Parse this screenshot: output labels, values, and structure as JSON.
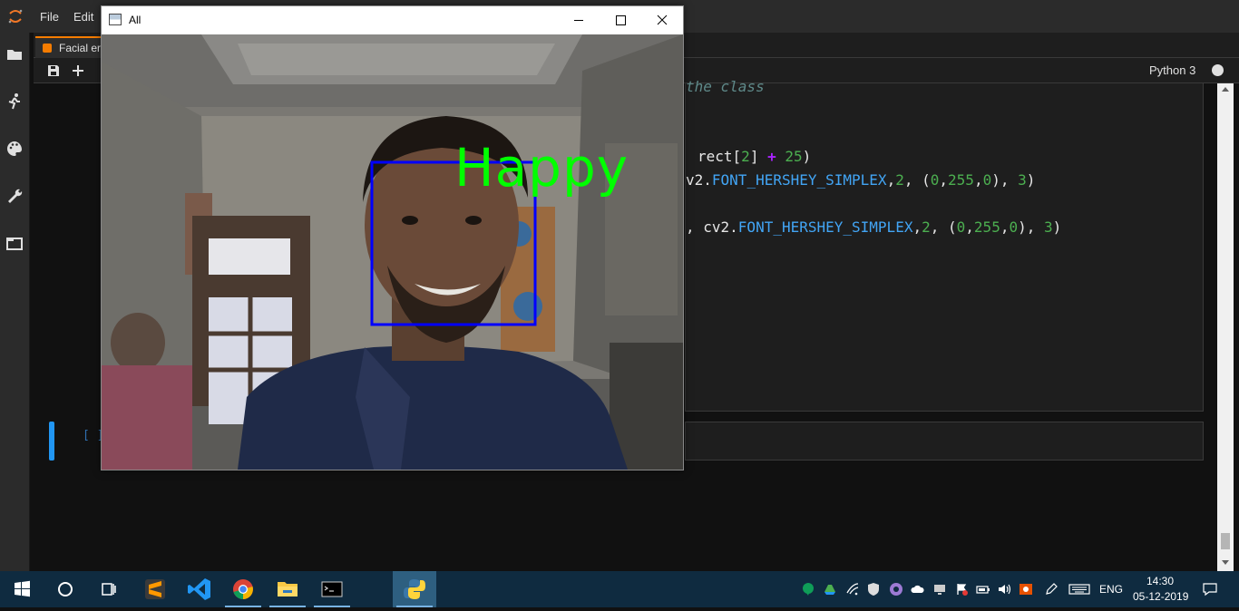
{
  "menubar": {
    "items": [
      {
        "label": "File"
      },
      {
        "label": "Edit"
      }
    ]
  },
  "leftbar": {
    "icons": [
      "folder-icon",
      "running-icon",
      "palette-icon",
      "wrench-icon",
      "tabs-icon"
    ]
  },
  "notebook_tab": {
    "label": "Facial er"
  },
  "toolbar": {
    "save_icon": "save-icon",
    "add_icon": "plus-icon",
    "kernel": "Python 3",
    "kernel_status_color": "#e0e0e0"
  },
  "code": {
    "comment_fragment": "the class",
    "line_rect_a": "rect[",
    "line_rect_b": "2",
    "line_rect_c": "] ",
    "line_rect_op": "+",
    "line_rect_num": "25",
    "line_rect_close": ")",
    "l2_prefix": "v2.",
    "l2_attr": "FONT_HERSHEY_SIMPLEX",
    "l2_comma": ",",
    "l2_size": "2",
    "l2_open": ", (",
    "l2_r": "0",
    "l2_c1": ",",
    "l2_g": "255",
    "l2_c2": ",",
    "l2_b": "0",
    "l2_close": "), ",
    "l2_thick": "3",
    "l2_end": ")",
    "l3_prefix": ", cv2.",
    "l3_attr": "FONT_HERSHEY_SIMPLEX",
    "l3_comma": ",",
    "l3_size": "2",
    "l3_open": ", (",
    "l3_r": "0",
    "l3_c1": ",",
    "l3_g": "255",
    "l3_c2": ",",
    "l3_b": "0",
    "l3_close": "), ",
    "l3_thick": "3",
    "l3_end": ")"
  },
  "empty_cell": {
    "prompt": "[ ]"
  },
  "cv_window": {
    "title": "All",
    "emotion_label": "Happy",
    "label_color": "#00ff00",
    "face_box_color": "#0000ff"
  },
  "taskbar": {
    "apps": [
      "windows-start-icon",
      "cortana-icon",
      "task-view-icon",
      "sublime-text-icon",
      "vscode-icon",
      "chrome-icon",
      "file-explorer-icon",
      "terminal-icon",
      "python-icon"
    ],
    "language": "ENG",
    "time": "14:30",
    "date": "05-12-2019"
  }
}
